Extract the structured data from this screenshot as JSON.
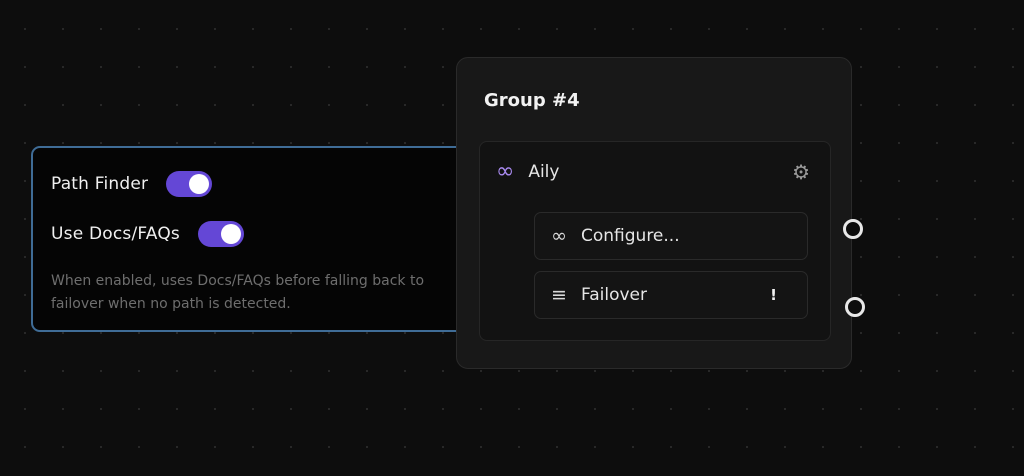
{
  "settings": {
    "path_finder_label": "Path Finder",
    "path_finder_enabled": true,
    "use_docs_label": "Use Docs/FAQs",
    "use_docs_enabled": true,
    "description": "When enabled, uses Docs/FAQs before falling back to failover when no path is detected."
  },
  "group": {
    "title": "Group #4",
    "agent": {
      "icon": "infinity-icon",
      "name": "Aily",
      "settings_icon": "gear-icon"
    },
    "buttons": [
      {
        "icon": "infinity-icon",
        "label": "Configure..."
      },
      {
        "icon": "menu-icon",
        "label": "Failover",
        "badge": "!"
      }
    ]
  },
  "colors": {
    "toggle_on": "#6447d6",
    "selected_border": "#3f6c96",
    "accent_icon": "#a98af0"
  }
}
